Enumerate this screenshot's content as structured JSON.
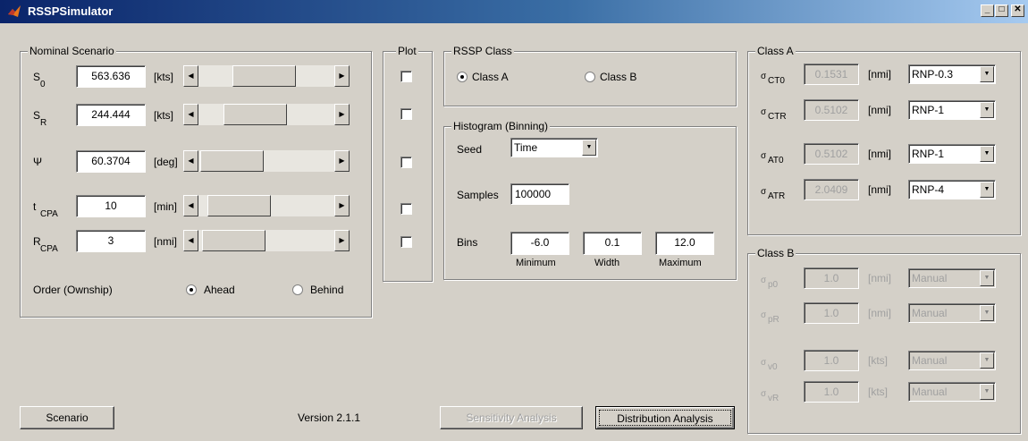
{
  "window": {
    "title": "RSSPSimulator",
    "controls": {
      "minimize": "_",
      "maximize": "□",
      "close": "✕"
    }
  },
  "nominal": {
    "title": "Nominal Scenario",
    "rows": [
      {
        "sym": "S",
        "sub": "0",
        "value": "563.636",
        "unit": "[kts]",
        "slider": 0.47
      },
      {
        "sym": "S",
        "sub": "R",
        "value": "244.444",
        "unit": "[kts]",
        "slider": 0.34
      },
      {
        "sym": "Ψ",
        "sub": "",
        "value": "60.3704",
        "unit": "[deg]",
        "slider": 0.03
      },
      {
        "sym": "t",
        "sub": "CPA",
        "value": "10",
        "unit": "[min]",
        "slider": 0.12
      },
      {
        "sym": "R",
        "sub": "CPA",
        "value": "3",
        "unit": "[nmi]",
        "slider": 0.05
      }
    ],
    "order_label": "Order (Ownship)",
    "ahead": "Ahead",
    "behind": "Behind"
  },
  "plot": {
    "title": "Plot"
  },
  "rssp": {
    "title": "RSSP Class",
    "class_a": "Class A",
    "class_b": "Class B"
  },
  "histogram": {
    "title": "Histogram (Binning)",
    "seed_label": "Seed",
    "seed_value": "Time",
    "samples_label": "Samples",
    "samples_value": "100000",
    "bins_label": "Bins",
    "min_value": "-6.0",
    "width_value": "0.1",
    "max_value": "12.0",
    "min_label": "Minimum",
    "width_label": "Width",
    "max_label": "Maximum"
  },
  "class_a": {
    "title": "Class A",
    "rows": [
      {
        "sym": "σ",
        "sub": "CT0",
        "value": "0.1531",
        "unit": "[nmi]",
        "option": "RNP-0.3"
      },
      {
        "sym": "σ",
        "sub": "CTR",
        "value": "0.5102",
        "unit": "[nmi]",
        "option": "RNP-1"
      },
      {
        "sym": "σ",
        "sub": "AT0",
        "value": "0.5102",
        "unit": "[nmi]",
        "option": "RNP-1"
      },
      {
        "sym": "σ",
        "sub": "ATR",
        "value": "2.0409",
        "unit": "[nmi]",
        "option": "RNP-4"
      }
    ]
  },
  "class_b": {
    "title": "Class B",
    "rows": [
      {
        "sym": "σ",
        "sub": "p0",
        "value": "1.0",
        "unit": "[nmi]",
        "option": "Manual"
      },
      {
        "sym": "σ",
        "sub": "pR",
        "value": "1.0",
        "unit": "[nmi]",
        "option": "Manual"
      },
      {
        "sym": "σ",
        "sub": "v0",
        "value": "1.0",
        "unit": "[kts]",
        "option": "Manual"
      },
      {
        "sym": "σ",
        "sub": "vR",
        "value": "1.0",
        "unit": "[kts]",
        "option": "Manual"
      }
    ]
  },
  "footer": {
    "scenario_button": "Scenario",
    "version": "Version 2.1.1",
    "sensitivity_button": "Sensitivity Analysis",
    "distribution_button": "Distribution Analysis"
  }
}
